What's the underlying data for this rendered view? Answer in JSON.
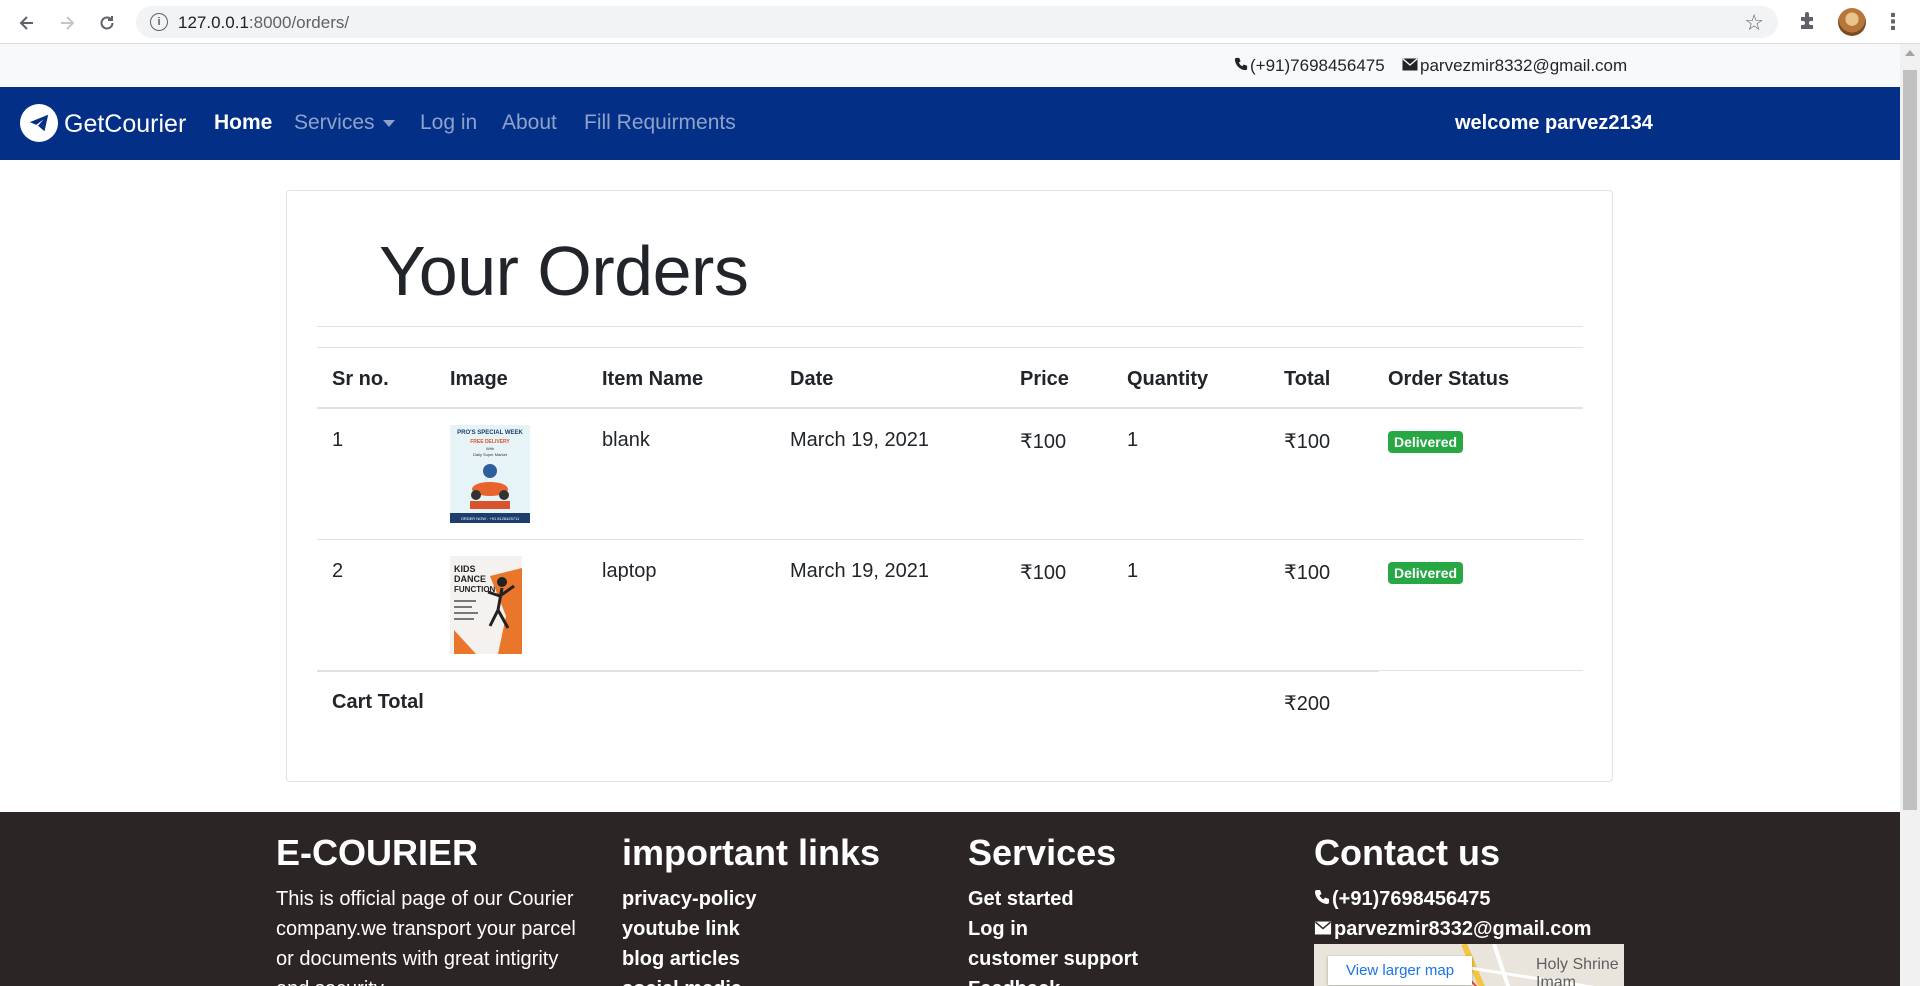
{
  "browser": {
    "url_host": "127.0.0.1",
    "url_path": ":8000/orders/"
  },
  "topbar": {
    "phone": "(+91)7698456475",
    "email": "parvezmir8332@gmail.com"
  },
  "navbar": {
    "brand": "GetCourier",
    "links": [
      {
        "label": "Home"
      },
      {
        "label": "Services"
      },
      {
        "label": "Log in"
      },
      {
        "label": "About"
      },
      {
        "label": "Fill Requirments"
      }
    ],
    "welcome": "welcome parvez2134"
  },
  "orders": {
    "title": "Your Orders",
    "headers": [
      "Sr no.",
      "Image",
      "Item Name",
      "Date",
      "Price",
      "Quantity",
      "Total",
      "Order Status"
    ],
    "rows": [
      {
        "sr": "1",
        "item": "blank",
        "date": "March 19, 2021",
        "price": "₹100",
        "qty": "1",
        "total": "₹100",
        "status": "Delivered"
      },
      {
        "sr": "2",
        "item": "laptop",
        "date": "March 19, 2021",
        "price": "₹100",
        "qty": "1",
        "total": "₹100",
        "status": "Delivered"
      }
    ],
    "cart_total_label": "Cart Total",
    "cart_total_value": "₹200",
    "status_color": "#28a745"
  },
  "thumbs": {
    "one": {
      "title": "PRO'S SPECIAL WEEK",
      "line1": "FREE DELIVERY",
      "line2": "With",
      "line3": "Daily Super Market",
      "footer": "ORDER NOW : +91 8128425711"
    },
    "two": {
      "line1": "KIDS",
      "line2": "DANCE",
      "line3": "FUNCTION"
    }
  },
  "footer": {
    "col1": {
      "heading": "E-COURIER",
      "text": "This is official page of our Courier company.we transport your parcel or documents with great intigrity and security."
    },
    "col2": {
      "heading": "important links",
      "links": [
        "privacy-policy",
        "youtube link",
        "blog articles",
        "social media"
      ]
    },
    "col3": {
      "heading": "Services",
      "links": [
        "Get started",
        "Log in",
        "customer support",
        "Feedback"
      ]
    },
    "col4": {
      "heading": "Contact us",
      "phone": "(+91)7698456475",
      "email": "parvezmir8332@gmail.com",
      "map_button": "View larger map",
      "map_label1": "Holy Shrine",
      "map_label2": "Imam Husain"
    }
  },
  "colors": {
    "navbar": "#032f87",
    "footer": "#2b2625",
    "badge": "#28a745"
  }
}
